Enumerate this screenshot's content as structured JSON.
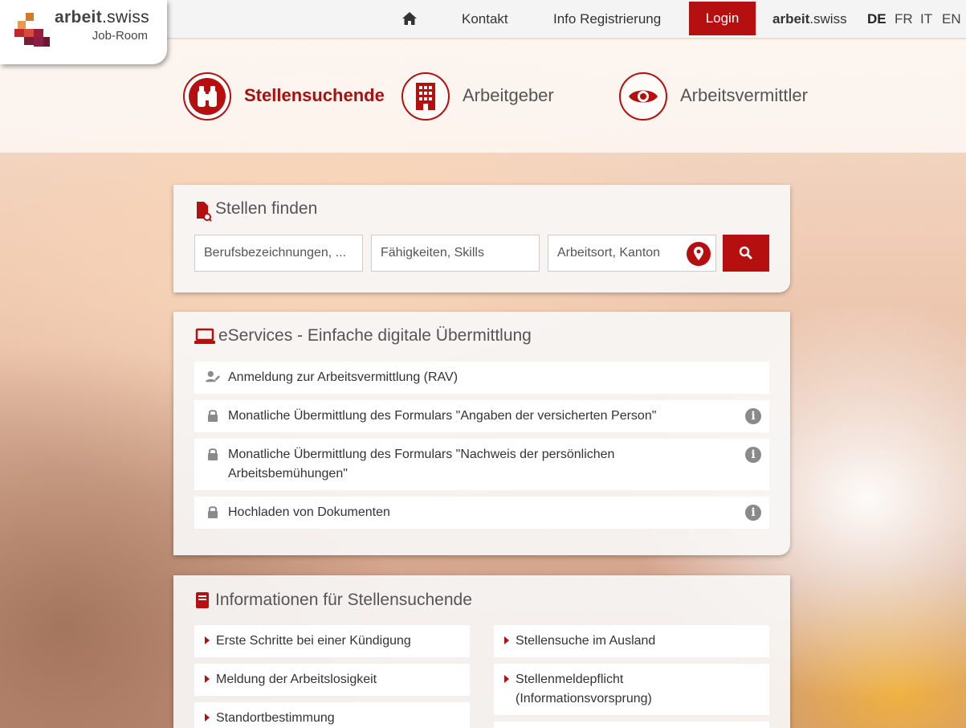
{
  "brand": {
    "name_bold": "arbeit",
    "name_rest": ".swiss",
    "subtitle": "Job-Room"
  },
  "topnav": {
    "home_icon": "home-icon",
    "contact": "Kontakt",
    "registration_info": "Info Registrierung",
    "login": "Login",
    "portal_bold": "arbeit",
    "portal_rest": ".swiss",
    "languages": [
      "DE",
      "FR",
      "IT",
      "EN"
    ],
    "active_language": "DE"
  },
  "audience_tabs": [
    {
      "label": "Stellensuchende",
      "icon": "binoculars-icon",
      "active": true
    },
    {
      "label": "Arbeitgeber",
      "icon": "building-icon",
      "active": false
    },
    {
      "label": "Arbeitsvermittler",
      "icon": "eye-icon",
      "active": false
    }
  ],
  "job_search": {
    "title": "Stellen finden",
    "occupation_placeholder": "Berufsbezeichnungen, ...",
    "skills_placeholder": "Fähigkeiten, Skills",
    "location_placeholder": "Arbeitsort, Kanton"
  },
  "eservices": {
    "title": "eServices - Einfache digitale Übermittlung",
    "items": [
      {
        "label": "Anmeldung zur Arbeitsvermittlung (RAV)",
        "icon": "user-edit-icon",
        "info": false
      },
      {
        "label": "Monatliche Übermittlung des Formulars \"Angaben der versicherten Person\"",
        "icon": "lock-icon",
        "info": true
      },
      {
        "label": "Monatliche Übermittlung des Formulars \"Nachweis der persönlichen Arbeitsbemühungen\"",
        "icon": "lock-icon",
        "info": true
      },
      {
        "label": "Hochladen von Dokumenten",
        "icon": "lock-icon",
        "info": true
      }
    ]
  },
  "info_section": {
    "title": "Informationen für Stellensuchende",
    "left_links": [
      "Erste Schritte bei einer Kündigung",
      "Meldung der Arbeitslosigkeit",
      "Standortbestimmung"
    ],
    "right_links": [
      "Stellensuche im Ausland",
      "Stellenmeldepflicht (Informationsvorsprung)"
    ]
  },
  "colors": {
    "accent": "#b50f0f"
  }
}
